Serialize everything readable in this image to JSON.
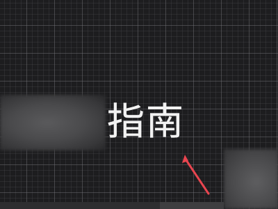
{
  "canvas": {
    "text_object": "指南",
    "background_color": "#1d1d1f",
    "grid_color": "#5a5a5e",
    "text_color": "#f2f2f2",
    "arrow_color": "#e8454f"
  },
  "annotation": {
    "icon": "red-pointer-arrow-icon"
  }
}
